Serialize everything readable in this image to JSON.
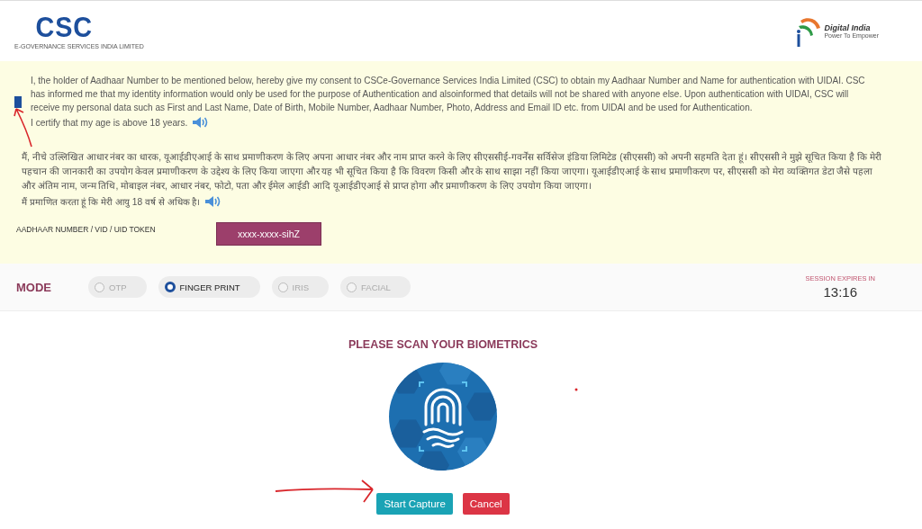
{
  "header": {
    "logo": {
      "letters": "CSC",
      "tagline": "E-GOVERNANCE SERVICES INDIA LIMITED"
    },
    "partner_logo": {
      "name": "Digital India",
      "tagline": "Power To Empower"
    }
  },
  "consent": {
    "checked": true,
    "english": {
      "text": "I, the holder of Aadhaar Number to be mentioned below, hereby give my consent to CSCe-Governance Services India Limited (CSC) to obtain my Aadhaar Number and Name for authentication with UIDAI. CSC has informed me that my identity information would only be used for the purpose of Authentication and alsoinformed that details will not be shared with anyone else. Upon authentication with UIDAI, CSC will receive my personal data such as First and Last Name, Date of Birth, Mobile Number, Aadhaar Number, Photo, Address and Email ID etc. from UIDAI and be used for Authentication.",
      "age_line": "I certify that my age is above 18 years."
    },
    "hindi": {
      "text": "मैं, नीचे उल्लिखित आधार नंबर का धारक, यूआईडीएआई के साथ प्रमाणीकरण के लिए अपना आधार नंबर और नाम प्राप्त करने के लिए सीएससीई-गवर्नेंस सर्विसेज इंडिया लिमिटेड (सीएससी) को अपनी सहमति देता हूं। सीएससी ने मुझे सूचित किया है कि मेरी पहचान की जानकारी का उपयोग केवल प्रमाणीकरण के उद्देश्य के लिए किया जाएगा और यह भी सूचित किया है कि विवरण किसी और के साथ साझा नहीं किया जाएगा। यूआईडीएआई के साथ प्रमाणीकरण पर, सीएससी को मेरा व्यक्तिगत डेटा जैसे पहला और अंतिम नाम, जन्म तिथि, मोबाइल नंबर, आधार नंबर, फोटो, पता और ईमेल आईडी आदि यूआईडीएआई से प्राप्त होगा और प्रमाणीकरण के लिए उपयोग किया जाएगा।",
      "age_line": "मैं प्रमाणित करता हूं कि मेरी आयु 18 वर्ष से अधिक है।"
    }
  },
  "aadhaar": {
    "label": "AADHAAR NUMBER / VID / UID TOKEN",
    "value": "xxxx-xxxx-sihZ"
  },
  "mode": {
    "label": "MODE",
    "options": [
      {
        "label": "OTP",
        "selected": false
      },
      {
        "label": "FINGER PRINT",
        "selected": true
      },
      {
        "label": "IRIS",
        "selected": false
      },
      {
        "label": "FACIAL",
        "selected": false
      }
    ]
  },
  "session": {
    "label": "SESSION EXPIRES IN",
    "time": "13:16"
  },
  "scan": {
    "title": "PLEASE SCAN YOUR BIOMETRICS"
  },
  "buttons": [
    {
      "label": "Start Capture",
      "kind": "primary"
    },
    {
      "label": "Cancel",
      "kind": "danger"
    }
  ]
}
